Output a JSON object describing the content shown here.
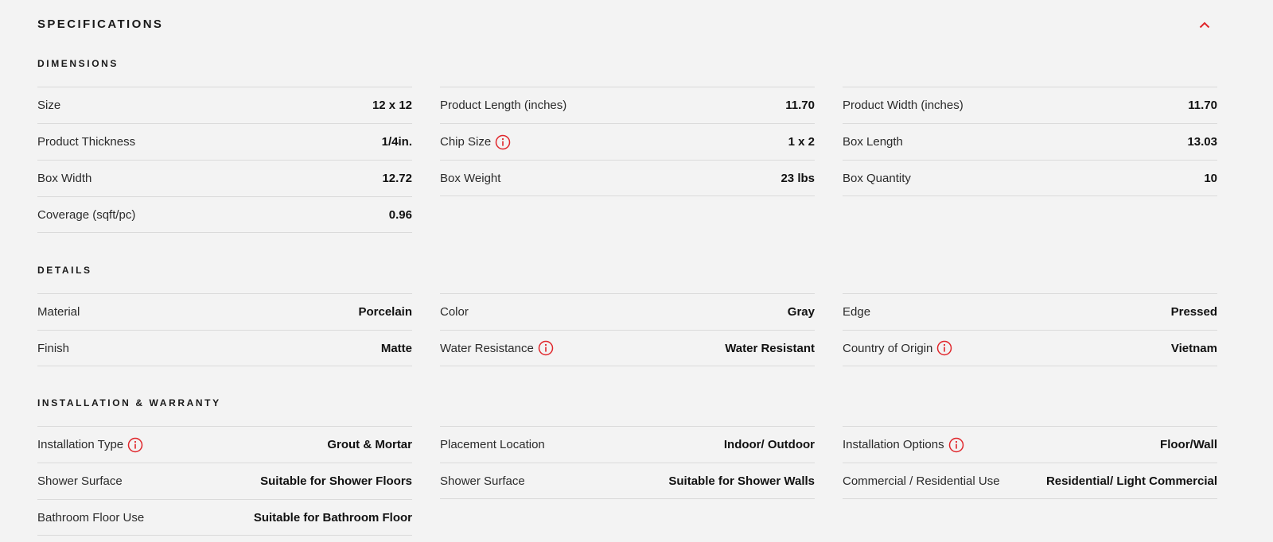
{
  "title": "SPECIFICATIONS",
  "accent_color": "#e0262b",
  "collapse_icon": "chevron-up-icon",
  "info_icon": "info-circle-icon",
  "sections": [
    {
      "title": "DIMENSIONS",
      "columns": [
        [
          {
            "label": "Size",
            "value": "12 x 12"
          },
          {
            "label": "Product Thickness",
            "value": "1/4in."
          },
          {
            "label": "Box Width",
            "value": "12.72"
          },
          {
            "label": "Coverage (sqft/pc)",
            "value": "0.96"
          }
        ],
        [
          {
            "label": "Product Length (inches)",
            "value": "11.70"
          },
          {
            "label": "Chip Size",
            "value": "1 x 2",
            "info": true
          },
          {
            "label": "Box Weight",
            "value": "23 lbs"
          }
        ],
        [
          {
            "label": "Product Width (inches)",
            "value": "11.70"
          },
          {
            "label": "Box Length",
            "value": "13.03"
          },
          {
            "label": "Box Quantity",
            "value": "10"
          }
        ]
      ]
    },
    {
      "title": "DETAILS",
      "columns": [
        [
          {
            "label": "Material",
            "value": "Porcelain"
          },
          {
            "label": "Finish",
            "value": "Matte"
          }
        ],
        [
          {
            "label": "Color",
            "value": "Gray"
          },
          {
            "label": "Water Resistance",
            "value": "Water Resistant",
            "info": true
          }
        ],
        [
          {
            "label": "Edge",
            "value": "Pressed"
          },
          {
            "label": "Country of Origin",
            "value": "Vietnam",
            "info": true
          }
        ]
      ]
    },
    {
      "title": "INSTALLATION & WARRANTY",
      "columns": [
        [
          {
            "label": "Installation Type",
            "value": "Grout & Mortar",
            "info": true
          },
          {
            "label": "Shower Surface",
            "value": "Suitable for Shower Floors"
          },
          {
            "label": "Bathroom Floor Use",
            "value": "Suitable for Bathroom Floor"
          }
        ],
        [
          {
            "label": "Placement Location",
            "value": "Indoor/ Outdoor"
          },
          {
            "label": "Shower Surface",
            "value": "Suitable for Shower Walls"
          }
        ],
        [
          {
            "label": "Installation Options",
            "value": "Floor/Wall",
            "info": true
          },
          {
            "label": "Commercial / Residential Use",
            "value": "Residential/ Light Commercial"
          }
        ]
      ]
    }
  ]
}
